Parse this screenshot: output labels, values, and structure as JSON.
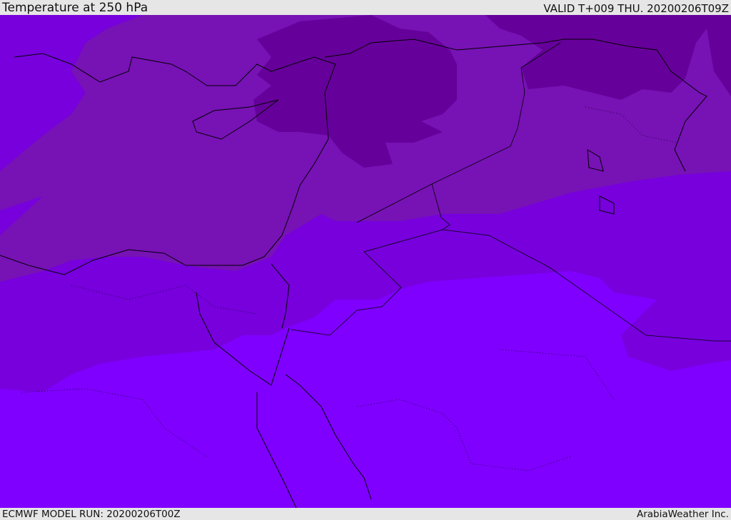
{
  "header": {
    "title": "Temperature at 250 hPa",
    "valid": "VALID T+009 THU. 20200206T09Z"
  },
  "footer": {
    "model_run": "ECMWF MODEL RUN: 20200206T00Z",
    "credit": "ArabiaWeather Inc."
  },
  "colors": {
    "warmest": "#7f00ff",
    "warm": "#7700dd",
    "cool": "#7712b5",
    "coldest": "#66009a"
  }
}
